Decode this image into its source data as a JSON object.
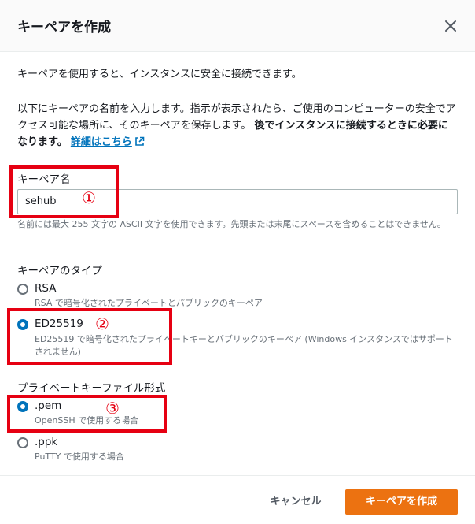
{
  "dialog": {
    "title": "キーペアを作成",
    "close_icon": "close-icon"
  },
  "intro": {
    "line1": "キーペアを使用すると、インスタンスに安全に接続できます。",
    "line2_normal": "以下にキーペアの名前を入力します。指示が表示されたら、ご使用のコンピューターの安全でアクセス可能な場所に、そのキーペアを保存します。",
    "line2_bold": "後でインスタンスに接続するときに必要になります。",
    "learn_more": "詳細はこちら",
    "learn_more_icon": "external-link-icon"
  },
  "key_name": {
    "label": "キーペア名",
    "value": "sehub",
    "hint": "名前には最大 255 文字の ASCII 文字を使用できます。先頭または末尾にスペースを含めることはできません。"
  },
  "key_type": {
    "label": "キーペアのタイプ",
    "options": [
      {
        "label": "RSA",
        "description": "RSA で暗号化されたプライベートとパブリックのキーペア",
        "selected": false
      },
      {
        "label": "ED25519",
        "description": "ED25519 で暗号化されたプライベートキーとパブリックのキーペア (Windows インスタンスではサポートされません)",
        "selected": true
      }
    ]
  },
  "key_format": {
    "label": "プライベートキーファイル形式",
    "options": [
      {
        "label": ".pem",
        "description": "OpenSSH で使用する場合",
        "selected": true
      },
      {
        "label": ".ppk",
        "description": "PuTTY で使用する場合",
        "selected": false
      }
    ]
  },
  "footer": {
    "cancel_label": "キャンセル",
    "create_label": "キーペアを作成"
  },
  "annotations": {
    "marker1": "①",
    "marker2": "②",
    "marker3": "③",
    "highlight_color": "#e60012"
  },
  "colors": {
    "primary": "#ec7211",
    "link": "#0073bb",
    "radio_selected": "#0073bb",
    "muted_text": "#687078"
  }
}
